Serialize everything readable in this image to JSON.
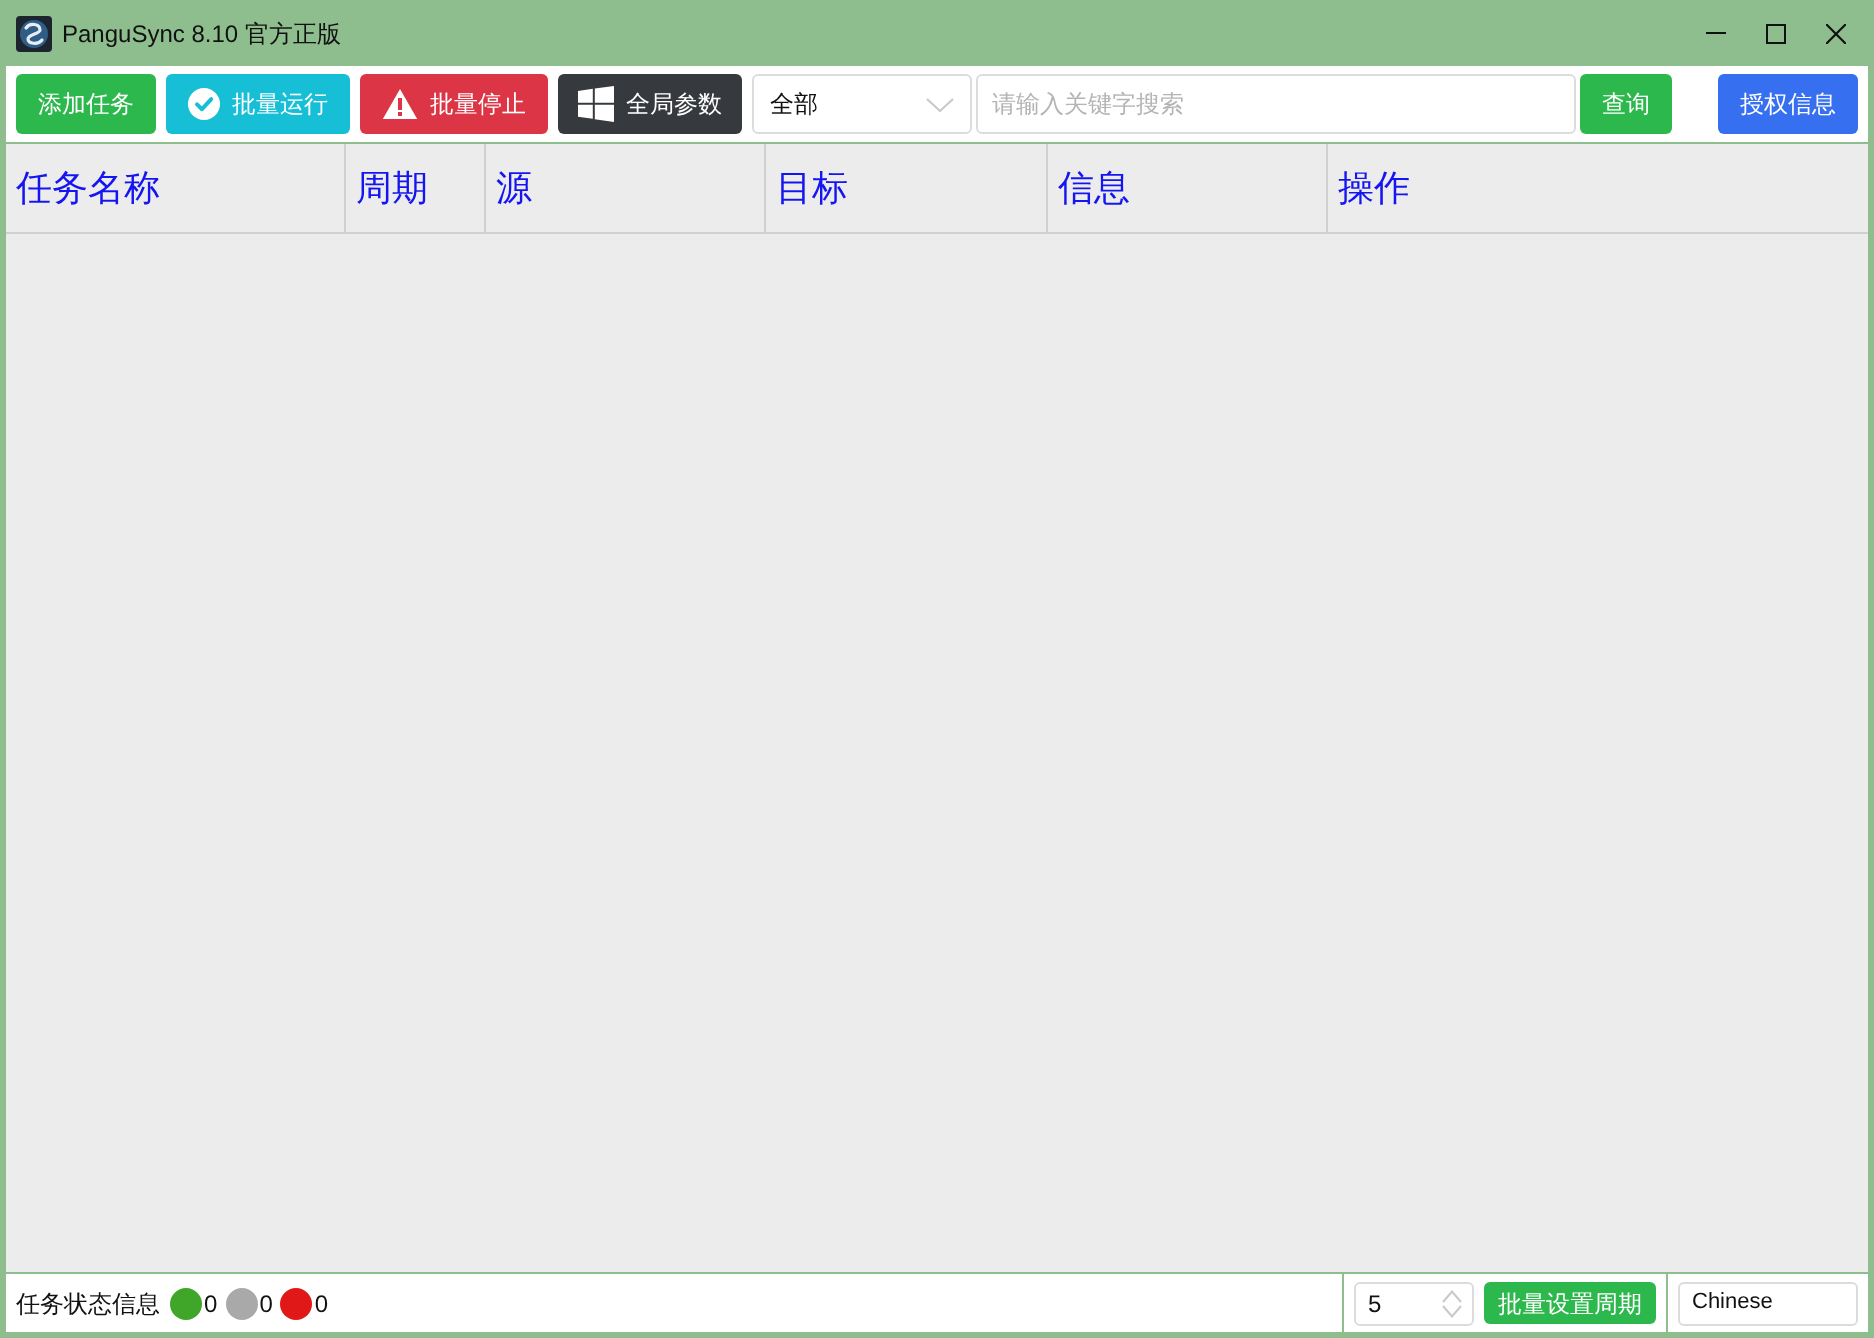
{
  "window": {
    "title": "PanguSync 8.10 官方正版"
  },
  "toolbar": {
    "buttons": [
      {
        "label": "添加任务",
        "kind": "add"
      },
      {
        "label": "批量运行",
        "kind": "run"
      },
      {
        "label": "批量停止",
        "kind": "stop"
      },
      {
        "label": "全局参数",
        "kind": "settings"
      }
    ],
    "filter": {
      "value": "全部"
    },
    "search": {
      "placeholder": "请输入关键字搜索"
    },
    "query_button": "查询",
    "license_button": "授权信息"
  },
  "table": {
    "columns": [
      "任务名称",
      "周期",
      "源",
      "目标",
      "信息",
      "操作"
    ]
  },
  "status_bar": {
    "label": "任务状态信息",
    "counters": [
      {
        "color": "#3fa62a",
        "count": "0"
      },
      {
        "color": "#a9a9a9",
        "count": "0"
      },
      {
        "color": "#e01818",
        "count": "0"
      }
    ],
    "period": {
      "value": "5"
    },
    "period_button": "批量设置周期",
    "language": {
      "value": "Chinese"
    }
  }
}
